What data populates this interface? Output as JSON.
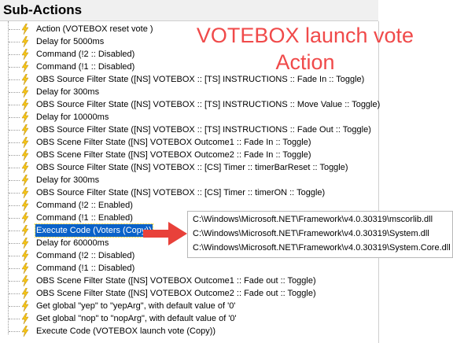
{
  "panel": {
    "title": "Sub-Actions"
  },
  "annotation": {
    "line1": "VOTEBOX launch vote",
    "line2": "Action"
  },
  "icons": {
    "bolt": "lightning-bolt-icon",
    "bolt_color": "#f5c518"
  },
  "colors": {
    "selection": "#0a62c9",
    "annotation": "#f04a4a",
    "arrow": "#e8413a"
  },
  "sub_actions": [
    {
      "label": "Action (VOTEBOX reset vote )"
    },
    {
      "label": "Delay for 5000ms"
    },
    {
      "label": "Command (!2 :: Disabled)"
    },
    {
      "label": "Command (!1 :: Disabled)"
    },
    {
      "label": "OBS Source Filter State ([NS] VOTEBOX :: [TS] INSTRUCTIONS :: Fade In :: Toggle)"
    },
    {
      "label": "Delay for 300ms"
    },
    {
      "label": "OBS Source Filter State ([NS] VOTEBOX :: [TS] INSTRUCTIONS :: Move Value :: Toggle)"
    },
    {
      "label": "Delay for 10000ms"
    },
    {
      "label": "OBS Source Filter State ([NS] VOTEBOX :: [TS] INSTRUCTIONS :: Fade Out :: Toggle)"
    },
    {
      "label": "OBS Scene Filter State ([NS] VOTEBOX Outcome1 :: Fade In :: Toggle)"
    },
    {
      "label": "OBS Scene Filter State ([NS] VOTEBOX Outcome2 :: Fade In :: Toggle)"
    },
    {
      "label": "OBS Source Filter State ([NS] VOTEBOX :: [CS] Timer :: timerBarReset :: Toggle)"
    },
    {
      "label": "Delay for 300ms"
    },
    {
      "label": "OBS Source Filter State ([NS] VOTEBOX :: [CS] Timer :: timerON :: Toggle)"
    },
    {
      "label": "Command (!2 :: Enabled)"
    },
    {
      "label": "Command (!1 :: Enabled)"
    },
    {
      "label": "Execute Code (Voters (Copy))",
      "selected": true
    },
    {
      "label": "Delay for 60000ms"
    },
    {
      "label": "Command (!2 :: Disabled)"
    },
    {
      "label": "Command (!1 :: Disabled)"
    },
    {
      "label": "OBS Scene Filter State ([NS] VOTEBOX Outcome1 :: Fade out :: Toggle)"
    },
    {
      "label": "OBS Scene Filter State ([NS] VOTEBOX Outcome2 :: Fade out :: Toggle)"
    },
    {
      "label": "Get global \"yep\" to \"yepArg\", with default value of '0'"
    },
    {
      "label": "Get global \"nop\" to \"nopArg\", with default value of '0'"
    },
    {
      "label": "Execute Code (VOTEBOX launch vote (Copy))"
    }
  ],
  "references_popup": {
    "items": [
      "C:\\Windows\\Microsoft.NET\\Framework\\v4.0.30319\\mscorlib.dll",
      "C:\\Windows\\Microsoft.NET\\Framework\\v4.0.30319\\System.dll",
      "C:\\Windows\\Microsoft.NET\\Framework\\v4.0.30319\\System.Core.dll"
    ]
  }
}
